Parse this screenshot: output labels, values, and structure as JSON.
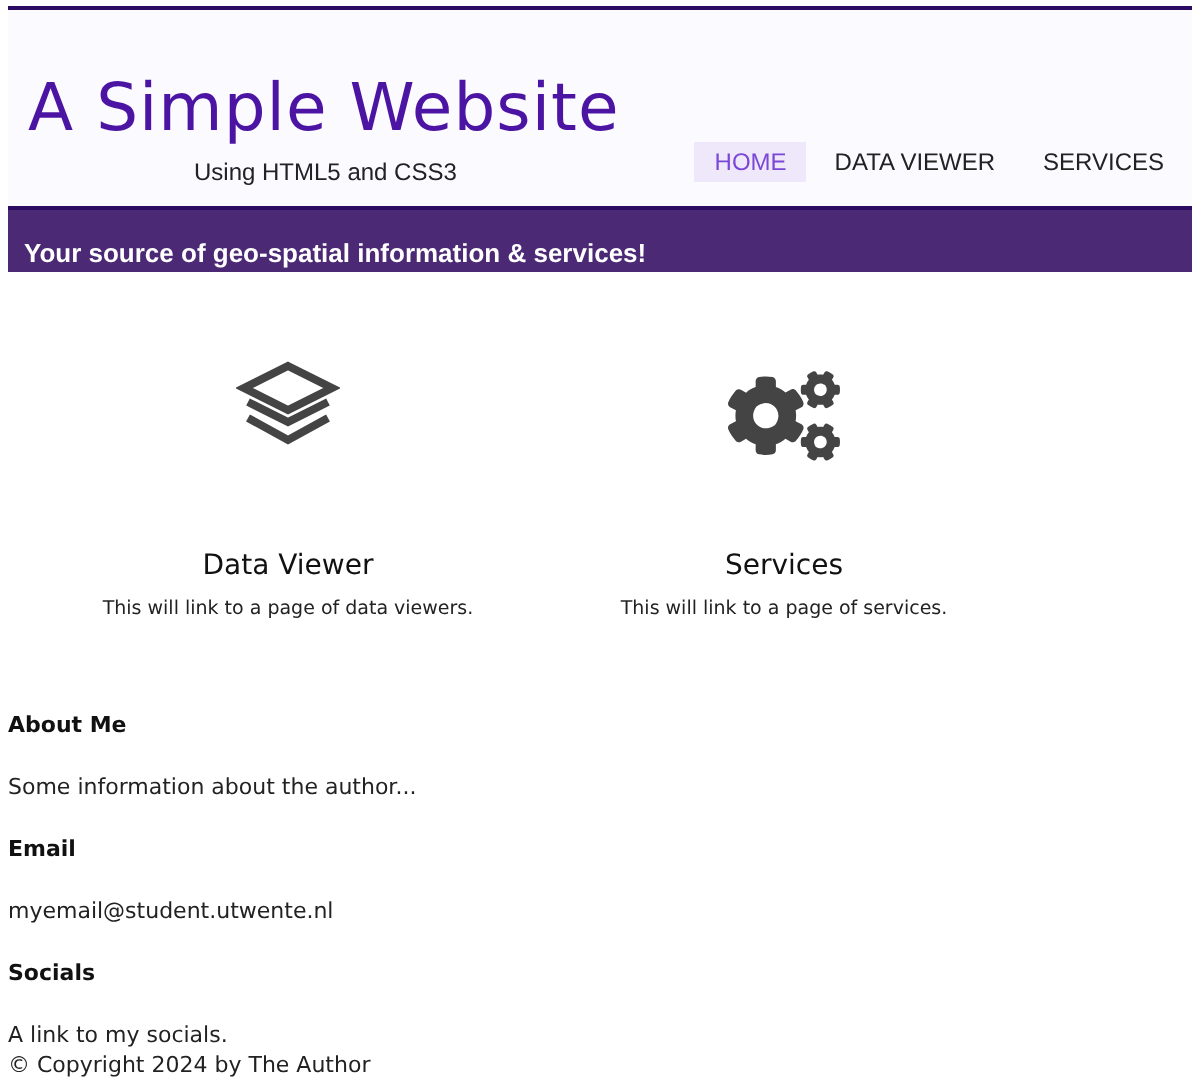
{
  "header": {
    "title": "A Simple Website",
    "subtitle": "Using HTML5 and CSS3"
  },
  "nav": [
    {
      "label": "HOME",
      "selected": true
    },
    {
      "label": "DATA VIEWER",
      "selected": false
    },
    {
      "label": "SERVICES",
      "selected": false
    }
  ],
  "banner": "Your source of geo-spatial information & services!",
  "features": [
    {
      "kind": "layers",
      "title": "Data Viewer",
      "text": "This will link to a page of data viewers."
    },
    {
      "kind": "gears",
      "title": "Services",
      "text": "This will link to a page of services."
    }
  ],
  "footer": {
    "sections": [
      {
        "heading": "About Me",
        "text": "Some information about the author..."
      },
      {
        "heading": "Email",
        "text": "myemail@student.utwente.nl"
      },
      {
        "heading": "Socials",
        "text": "A link to my socials."
      }
    ],
    "copyright": "© Copyright 2024 by The Author"
  }
}
